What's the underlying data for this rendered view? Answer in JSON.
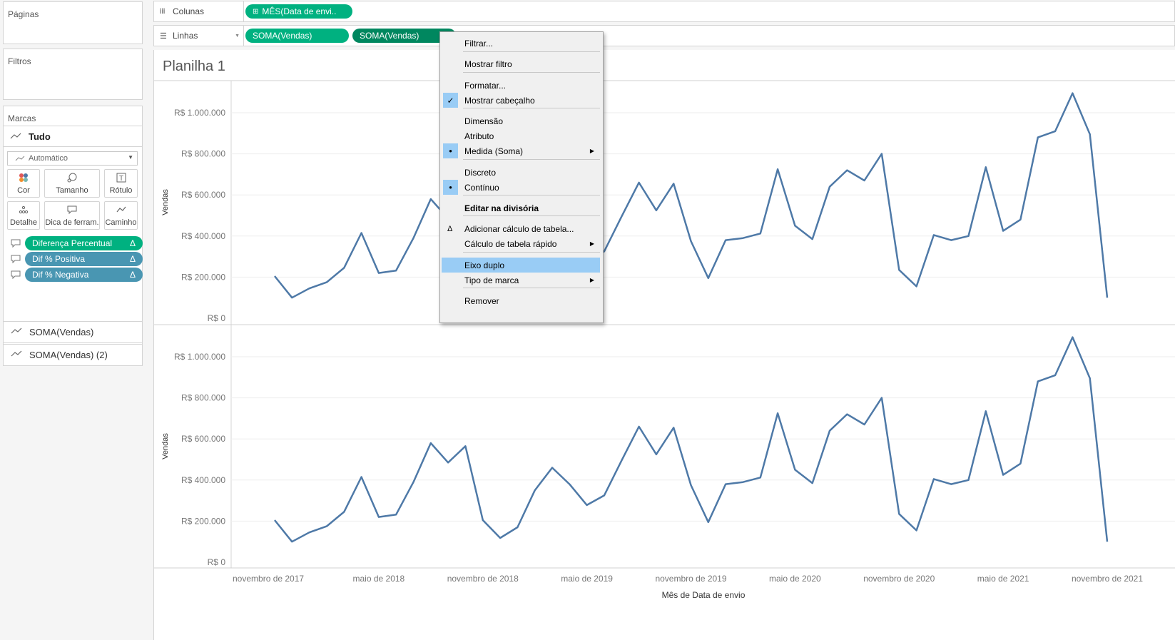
{
  "left": {
    "pages_title": "Páginas",
    "filters_title": "Filtros",
    "marks_title": "Marcas",
    "marks_all": "Tudo",
    "mark_type": "Automático",
    "buttons": [
      {
        "label": "Cor",
        "icon": "color-dots-icon"
      },
      {
        "label": "Tamanho",
        "icon": "size-icon"
      },
      {
        "label": "Rótulo",
        "icon": "label-icon"
      },
      {
        "label": "Detalhe",
        "icon": "detail-icon"
      },
      {
        "label": "Dica de ferram.",
        "icon": "tooltip-icon"
      },
      {
        "label": "Caminho",
        "icon": "path-icon"
      }
    ],
    "mark_pills": [
      {
        "label": "Diferença Percentual",
        "badge": "Δ",
        "color": "#00b180"
      },
      {
        "label": "Dif % Positiva",
        "badge": "Δ",
        "color": "#4996b2"
      },
      {
        "label": "Dif % Negativa",
        "badge": "Δ",
        "color": "#4996b2"
      }
    ],
    "measure_cards": [
      "SOMA(Vendas)",
      "SOMA(Vendas) (2)"
    ]
  },
  "shelves": {
    "columns_label": "Colunas",
    "rows_label": "Linhas",
    "columns_pill": "MÊS(Data de envi..",
    "rows_pills": [
      "SOMA(Vendas)",
      "SOMA(Vendas)"
    ]
  },
  "sheet_title": "Planilha 1",
  "context_menu": {
    "items": [
      {
        "label": "Filtrar..."
      },
      {
        "label": "Mostrar filtro"
      },
      {
        "label": "Formatar..."
      },
      {
        "label": "Mostrar cabeçalho",
        "checked": true
      },
      {
        "label": "Dimensão"
      },
      {
        "label": "Atributo"
      },
      {
        "label": "Medida (Soma)",
        "selected": true,
        "submenu": true
      },
      {
        "label": "Discreto"
      },
      {
        "label": "Contínuo",
        "selected": true
      },
      {
        "label": "Editar na divisória",
        "bold": true
      },
      {
        "label": "Adicionar cálculo de tabela...",
        "symbol": "Δ"
      },
      {
        "label": "Cálculo de tabela rápido",
        "submenu": true
      },
      {
        "label": "Eixo duplo",
        "highlighted": true
      },
      {
        "label": "Tipo de marca",
        "submenu": true
      },
      {
        "label": "Remover"
      }
    ]
  },
  "chart_data": {
    "type": "line",
    "xlabel": "Mês de Data de envio",
    "ylabel": "Vendas",
    "y_ticks": [
      "R$ 0",
      "R$ 200.000",
      "R$ 400.000",
      "R$ 600.000",
      "R$ 800.000",
      "R$ 1.000.000"
    ],
    "y_tick_values": [
      0,
      200000,
      400000,
      600000,
      800000,
      1000000
    ],
    "x_ticks": [
      "novembro de 2017",
      "maio de 2018",
      "novembro de 2018",
      "maio de 2019",
      "novembro de 2019",
      "maio de 2020",
      "novembro de 2020",
      "maio de 2021",
      "novembro de 2021"
    ],
    "x_tick_month_index": [
      0,
      6,
      12,
      18,
      24,
      30,
      36,
      42,
      48
    ],
    "line_color": "#4e79a7",
    "ylim": [
      0,
      1100000
    ],
    "series": [
      {
        "values": [
          205000,
          100000,
          145000,
          175000,
          245000,
          415000,
          220000,
          232000,
          390000,
          580000,
          485000,
          565000,
          205000,
          118000,
          170000,
          350000,
          460000,
          380000,
          278000,
          325000,
          495000,
          660000,
          525000,
          655000,
          375000,
          195000,
          380000,
          390000,
          412000,
          725000,
          450000,
          385000,
          640000,
          720000,
          670000,
          800000,
          235000,
          155000,
          405000,
          380000,
          400000,
          735000,
          425000,
          480000,
          880000,
          910000,
          1095000,
          895000,
          100000
        ]
      }
    ]
  }
}
